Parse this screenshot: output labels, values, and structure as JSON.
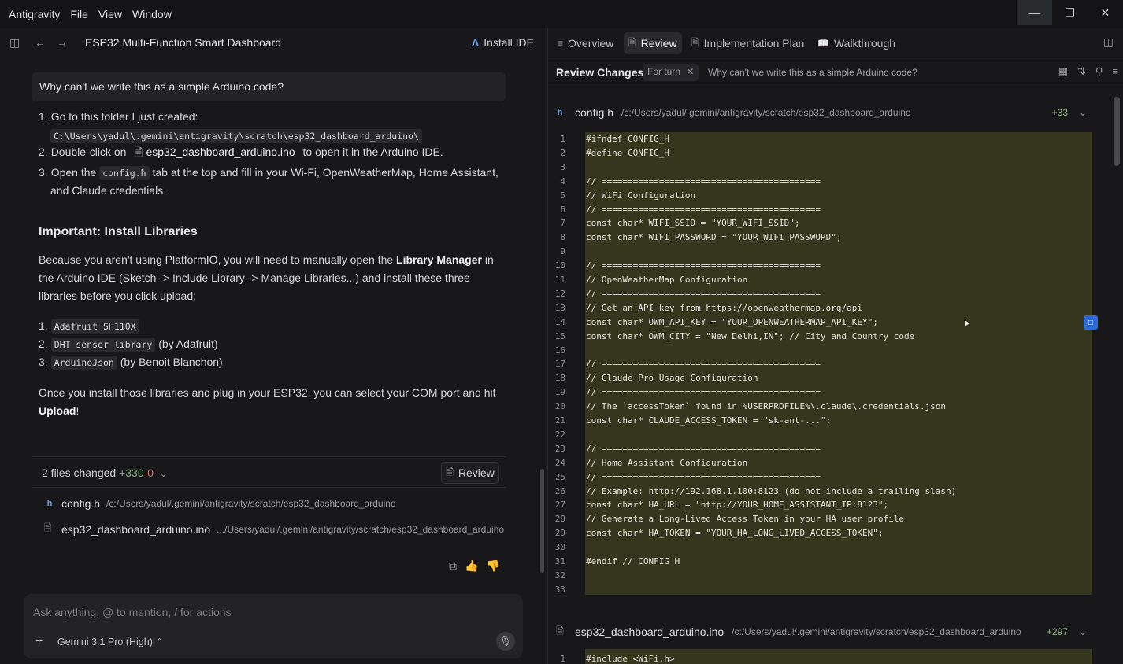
{
  "app": {
    "menu": [
      "Antigravity",
      "File",
      "View",
      "Window"
    ]
  },
  "left": {
    "title": "ESP32 Multi-Function Smart Dashboard",
    "install_label": "Install IDE",
    "user_question": "Why can't we write this as a simple Arduino code?",
    "steps": {
      "s1_text": "Go to this folder I just created:",
      "s1_path": "C:\\Users\\yadul\\.gemini\\antigravity\\scratch\\esp32_dashboard_arduino\\",
      "s2_pre": "Double-click on",
      "s2_file": "esp32_dashboard_arduino.ino",
      "s2_post": "to open it in the Arduino IDE.",
      "s3_pre": "Open the",
      "s3_code": "config.h",
      "s3_post": "tab at the top and fill in your Wi-Fi, OpenWeatherMap, Home Assistant,",
      "s3_post2": "and Claude credentials."
    },
    "heading": "Important: Install Libraries",
    "para1_a": "Because you aren't using PlatformIO, you will need to manually open the",
    "para1_b": "Library Manager",
    "para1_c": "in",
    "para1_d": "the Arduino IDE (Sketch -> Include Library -> Manage Libraries...) and install these three",
    "para1_e": "libraries before you click upload:",
    "libs": [
      {
        "code": "Adafruit SH110X",
        "note": ""
      },
      {
        "code": "DHT sensor library",
        "note": "(by Adafruit)"
      },
      {
        "code": "ArduinoJson",
        "note": "(by Benoit Blanchon)"
      }
    ],
    "para2_a": "Once you install those libraries and plug in your ESP32, you can select your COM port and hit",
    "para2_b": "Upload",
    "para2_c": "!",
    "files_changed": "2 files changed",
    "added": "+330",
    "removed": "-0",
    "review_label": "Review",
    "files": [
      {
        "name": "config.h",
        "path": "/c:/Users/yadul/.gemini/antigravity/scratch/esp32_dashboard_arduino"
      },
      {
        "name": "esp32_dashboard_arduino.ino",
        "path": ".../Users/yadul/.gemini/antigravity/scratch/esp32_dashboard_arduino"
      }
    ],
    "input_placeholder": "Ask anything, @ to mention, / for actions",
    "model": "Gemini 3.1 Pro (High)"
  },
  "right": {
    "tabs": [
      "Overview",
      "Review",
      "Implementation Plan",
      "Walkthrough"
    ],
    "header_title": "Review Changes",
    "for_turn": "For turn",
    "question": "Why can't we write this as a simple Arduino code?",
    "file1": {
      "name": "config.h",
      "path": "/c:/Users/yadul/.gemini/antigravity/scratch/esp32_dashboard_arduino",
      "added": "+33"
    },
    "file2": {
      "name": "esp32_dashboard_arduino.ino",
      "path": "/c:/Users/yadul/.gemini/antigravity/scratch/esp32_dashboard_arduino",
      "added": "+297"
    },
    "code1": [
      "#ifndef CONFIG_H",
      "#define CONFIG_H",
      "",
      "// ==========================================",
      "// WiFi Configuration",
      "// ==========================================",
      "const char* WIFI_SSID = \"YOUR_WIFI_SSID\";",
      "const char* WIFI_PASSWORD = \"YOUR_WIFI_PASSWORD\";",
      "",
      "// ==========================================",
      "// OpenWeatherMap Configuration",
      "// ==========================================",
      "// Get an API key from https://openweathermap.org/api",
      "const char* OWM_API_KEY = \"YOUR_OPENWEATHERMAP_API_KEY\";",
      "const char* OWM_CITY = \"New Delhi,IN\"; // City and Country code",
      "",
      "// ==========================================",
      "// Claude Pro Usage Configuration",
      "// ==========================================",
      "// The `accessToken` found in %USERPROFILE%\\.claude\\.credentials.json",
      "const char* CLAUDE_ACCESS_TOKEN = \"sk-ant-...\";",
      "",
      "// ==========================================",
      "// Home Assistant Configuration",
      "// ==========================================",
      "// Example: http://192.168.1.100:8123 (do not include a trailing slash)",
      "const char* HA_URL = \"http://YOUR_HOME_ASSISTANT_IP:8123\";",
      "// Generate a Long-Lived Access Token in your HA user profile",
      "const char* HA_TOKEN = \"YOUR_HA_LONG_LIVED_ACCESS_TOKEN\";",
      "",
      "#endif // CONFIG_H",
      "",
      ""
    ],
    "code2": [
      "#include <WiFi.h>"
    ]
  }
}
